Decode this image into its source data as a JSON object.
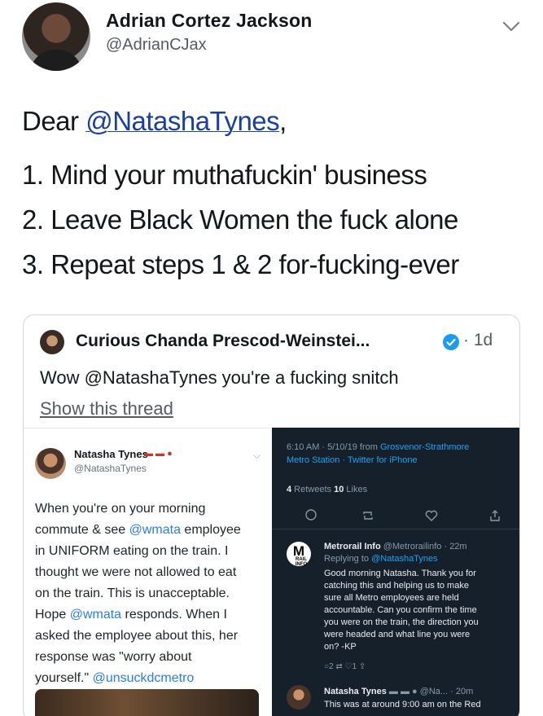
{
  "author": {
    "display_name": "Adrian Cortez Jackson",
    "handle": "@AdrianCJax"
  },
  "tweet": {
    "salutation_prefix": "Dear ",
    "salutation_mention": "@NatashaTynes",
    "salutation_suffix": ",",
    "lines": [
      "1. Mind your muthafuckin' business",
      "2. Leave Black Women the fuck alone",
      "3. Repeat steps 1 & 2 for-fucking-ever"
    ]
  },
  "quoted": {
    "name": "Curious Chanda Prescod-Weinstei...",
    "time": "· 1d",
    "text": "Wow @NatashaTynes you're a fucking snitch",
    "show_thread": "Show this thread"
  },
  "left_shot": {
    "name": "Natasha Tynes",
    "flags": "▬ ▬ ●",
    "handle": "@NatashaTynes",
    "body_lines": [
      {
        "pre": "When you're on your morning",
        "link": "",
        "post": ""
      },
      {
        "pre": "commute & see ",
        "link": "@wmata",
        "post": " employee"
      },
      {
        "pre": "in UNIFORM eating on the train. I",
        "link": "",
        "post": ""
      },
      {
        "pre": "thought we were not allowed to eat",
        "link": "",
        "post": ""
      },
      {
        "pre": "on the train. This is unacceptable.",
        "link": "",
        "post": ""
      },
      {
        "pre": "Hope ",
        "link": "@wmata",
        "post": " responds. When I"
      },
      {
        "pre": "asked the employee about this, her",
        "link": "",
        "post": ""
      },
      {
        "pre": "response was \"worry about",
        "link": "",
        "post": ""
      },
      {
        "pre": "yourself.\" ",
        "link": "@unsuckdcmetro",
        "post": ""
      }
    ]
  },
  "right_shot": {
    "meta_line1_pre": "6:10 AM · 5/10/19 from ",
    "meta_line1_link": "Grosvenor-Strathmore",
    "meta_line2_link": "Metro Station · Twitter for iPhone",
    "retweets_count": "4",
    "retweets_label": " Retweets ",
    "likes_count": "10",
    "likes_label": " Likes",
    "reply": {
      "logo": "M",
      "logo_small": "RAIL INFO",
      "name": "Metrorail Info",
      "handle_time": " @Metrorailinfo · 22m",
      "replying_pre": "Replying to ",
      "replying_link": "@NatashaTynes",
      "body_lines": [
        "Good morning Natasha. Thank you for",
        "catching this and helping us to make",
        "sure all Metro employees are held",
        "accountable. Can you confirm the time",
        "you were on the train, the direction you",
        "were headed and what line you were",
        "on? -KP"
      ],
      "actions": "○2        ⇄        ♡1        ⇧"
    },
    "second": {
      "name": "Natasha Tynes",
      "meta": " ▬ ▬ ● @Na... · 20m",
      "body": "This was at around 9:00 am on the Red"
    }
  }
}
